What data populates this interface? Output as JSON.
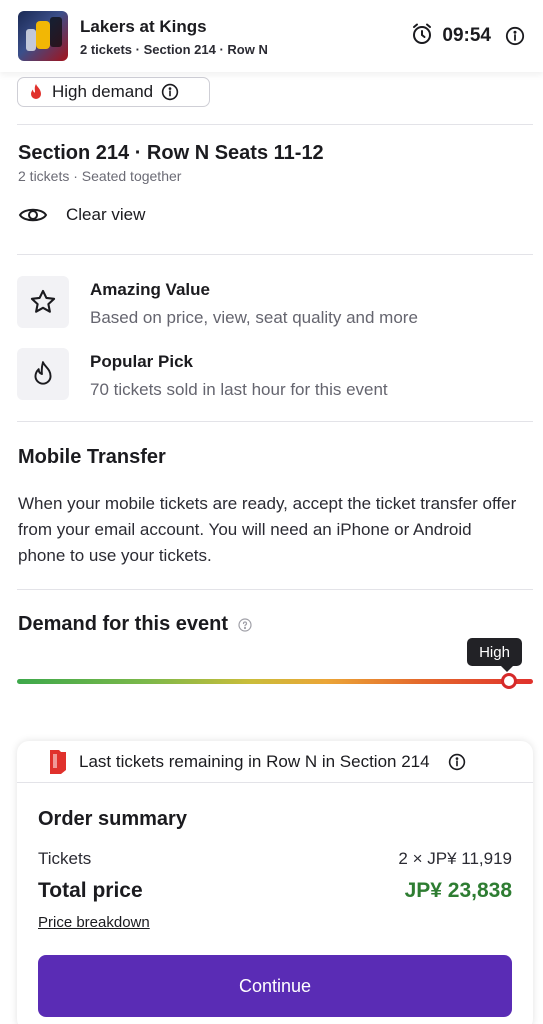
{
  "header": {
    "title": "Lakers at Kings",
    "subtitle": "2 tickets · Section 214 · Row N",
    "timer": "09:54",
    "icons": [
      "event-thumbnail",
      "alarm-clock-icon",
      "info-icon"
    ]
  },
  "badge": {
    "label": "High demand",
    "icon": "fire-icon"
  },
  "listing": {
    "title": "Section 214 · Row N Seats 11-12",
    "subtitle": "2 tickets · Seated together",
    "view_label": "Clear view"
  },
  "features": [
    {
      "title": "Amazing Value",
      "desc": "Based on price, view, seat quality and more",
      "icon": "star-icon"
    },
    {
      "title": "Popular Pick",
      "desc": "70 tickets sold in last hour for this event",
      "icon": "flame-icon"
    }
  ],
  "mobile_transfer": {
    "title": "Mobile Transfer",
    "body": "When your mobile tickets are ready, accept the ticket transfer offer from your email account. You will need an iPhone or Android phone to use your tickets."
  },
  "demand": {
    "title": "Demand for this event",
    "level_label": "High",
    "level_fraction": 0.954,
    "colors": {
      "low": "#3da84b",
      "mid": "#eba537",
      "high": "#e0312c"
    }
  },
  "order": {
    "notice": "Last tickets remaining in Row N in Section 214",
    "title": "Order summary",
    "tickets_label": "Tickets",
    "tickets_value": "2 × JP¥ 11,919",
    "total_label": "Total price",
    "total_value": "JP¥ 23,838",
    "breakdown_label": "Price breakdown",
    "continue_label": "Continue",
    "accent": "#5a2cb5",
    "total_color": "#2e7d32"
  }
}
